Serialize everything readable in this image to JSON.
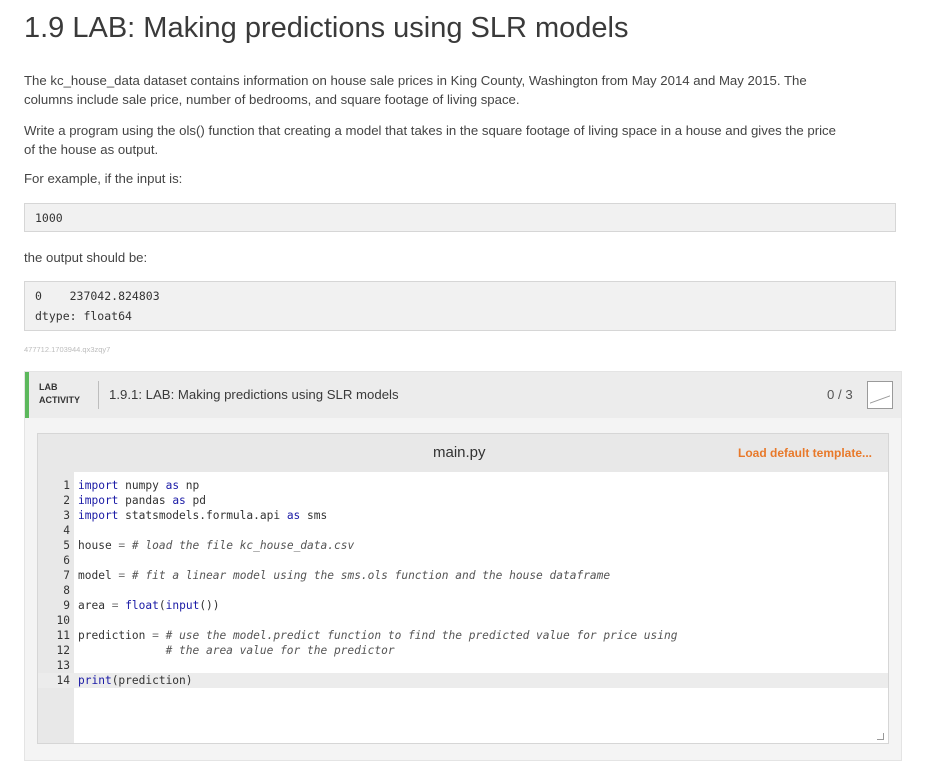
{
  "page": {
    "title": "1.9 LAB: Making predictions using SLR models",
    "para1_line1": "The kc_house_data dataset contains information on house sale prices in King County, Washington from May 2014 and May 2015. The",
    "para1_line2": "columns include sale price, number of bedrooms, and square footage of living space.",
    "para2_line1": "Write a program using the ols() function that creating a model that takes in the square footage of living space in a house and gives the price",
    "para2_line2": "of the house as output.",
    "para3": "For example, if the input is:",
    "example_input": "1000",
    "para4": "the output should be:",
    "example_output_line1": "0    237042.824803",
    "example_output_line2": "dtype: float64",
    "hash": "477712.1703944.qx3zqy7"
  },
  "lab": {
    "tag_line1": "LAB",
    "tag_line2": "ACTIVITY",
    "title": "1.9.1: LAB: Making predictions using SLR models",
    "score": "0 / 3"
  },
  "editor": {
    "filename": "main.py",
    "load_template": "Load default template...",
    "lines": [
      {
        "n": "1",
        "code": "import numpy as np"
      },
      {
        "n": "2",
        "code": "import pandas as pd"
      },
      {
        "n": "3",
        "code": "import statsmodels.formula.api as sms"
      },
      {
        "n": "4",
        "code": ""
      },
      {
        "n": "5",
        "code": "house = # load the file kc_house_data.csv"
      },
      {
        "n": "6",
        "code": ""
      },
      {
        "n": "7",
        "code": "model = # fit a linear model using the sms.ols function and the house dataframe"
      },
      {
        "n": "8",
        "code": ""
      },
      {
        "n": "9",
        "code": "area = float(input())"
      },
      {
        "n": "10",
        "code": ""
      },
      {
        "n": "11",
        "code": "prediction = # use the model.predict function to find the predicted value for price using"
      },
      {
        "n": "12",
        "code": "             # the area value for the predictor"
      },
      {
        "n": "13",
        "code": ""
      },
      {
        "n": "14",
        "code": "print(prediction)"
      }
    ]
  }
}
